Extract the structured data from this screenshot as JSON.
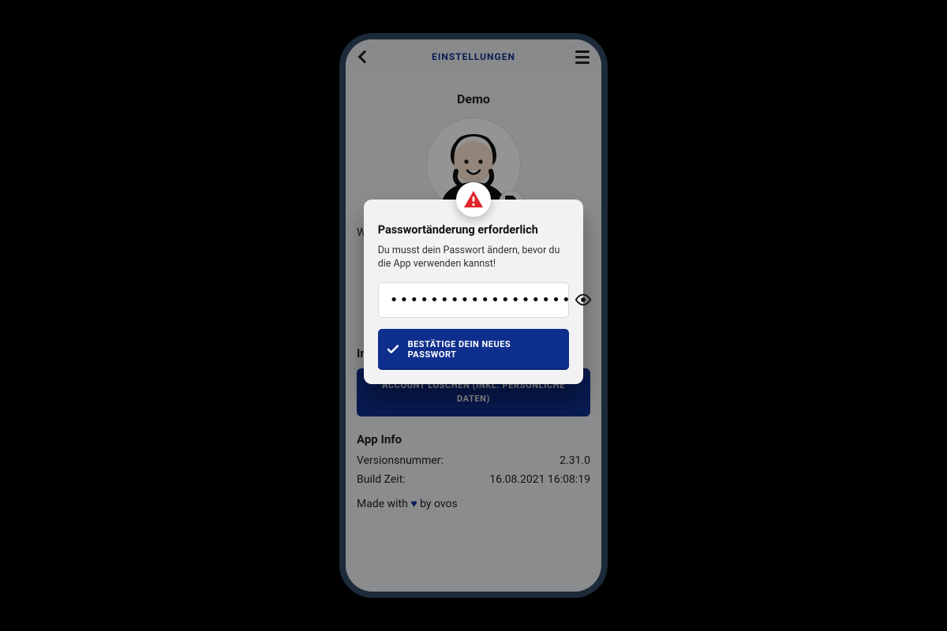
{
  "header": {
    "title": "EINSTELLUNGEN"
  },
  "profile": {
    "name": "Demo",
    "choose_label": "Wähle dein Profilbild"
  },
  "sections": {
    "content_title": "Inhalte verwalten",
    "delete_account_label": "ACCOUNT LÖSCHEN (INKL. PERSÖNLICHE DATEN)",
    "appinfo_title": "App Info",
    "version_label": "Versionsnummer:",
    "version_value": "2.31.0",
    "build_label": "Build Zeit:",
    "build_value": "16.08.2021 16:08:19",
    "made_prefix": "Made with ",
    "made_suffix": " by ovos"
  },
  "dialog": {
    "title": "Passwortänderung erforderlich",
    "body": "Du musst dein Passwort ändern, bevor du die App verwenden kannst!",
    "password_value": "••••••••••••••••••••",
    "confirm_label": "BESTÄTIGE DEIN NEUES PASSWORT"
  }
}
